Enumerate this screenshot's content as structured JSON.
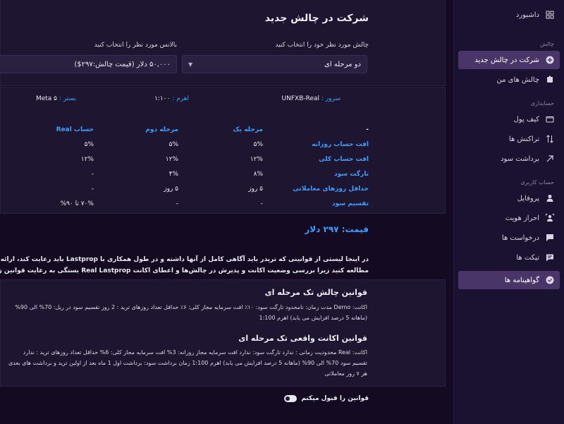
{
  "sidebar": {
    "items": [
      {
        "label": "داشبورد",
        "icon": "grid-icon"
      },
      {
        "group": "چالش"
      },
      {
        "label": "شرکت در چالش جدید",
        "icon": "plus-circle-icon",
        "active": true
      },
      {
        "label": "چالش های من",
        "icon": "trophy-icon"
      },
      {
        "group": "حسابداری"
      },
      {
        "label": "کیف پول",
        "icon": "wallet-icon"
      },
      {
        "label": "تراکنش ها",
        "icon": "swap-icon"
      },
      {
        "label": "برداشت سود",
        "icon": "arrow-out-icon"
      },
      {
        "group": "حساب کاربری"
      },
      {
        "label": "پروفایل",
        "icon": "user-icon"
      },
      {
        "label": "احراز هویت",
        "icon": "id-icon"
      },
      {
        "label": "درخواست ها",
        "icon": "chat-icon"
      },
      {
        "label": "تیکت ها",
        "icon": "ticket-icon"
      },
      {
        "label": "گواهینامه ها",
        "icon": "badge-icon",
        "active": true
      }
    ]
  },
  "main": {
    "title": "شرکت در چالش جدید",
    "challenge_label": "چالش مورد نظر خود را انتخاب کنید",
    "challenge_value": "دو مرحله ای",
    "balance_label": "بالانس مورد نظر را انتخاب کنید",
    "balance_value": "۵۰,۰۰۰ دلار (قیمت چالش:۲۹۷$)",
    "server_key": "سرور :",
    "server_value": "UNFXB-Real",
    "leverage_key": "اهرم :",
    "leverage_value": "۱:۱۰۰",
    "platform_key": "بستر :",
    "platform_value": "Meta ۵",
    "table": {
      "headers": [
        "-",
        "مرحله یک",
        "مرحله دوم",
        "حساب Real"
      ],
      "rows": [
        [
          "افت حساب روزانه",
          "۵%",
          "۵%",
          "۵%"
        ],
        [
          "افت حساب کلی",
          "۱۲%",
          "۱۲%",
          "۱۲%"
        ],
        [
          "تارگت سود",
          "۸%",
          "۴%",
          "-"
        ],
        [
          "حداقل روزهای معاملاتی",
          "۵ روز",
          "۵ روز",
          "-"
        ],
        [
          "تقسیم سود",
          "-",
          "-",
          "۷۰% تا ۹۰%"
        ]
      ]
    },
    "price": "قیمت: ۲۹۷ دلار",
    "desc_line1": "در اینجا لیستی از قوانینی که تریدر باید آگاهی کامل از آنها داشته و در طول همکاری با Lastprop باید رعایت کند، ارائه می‌دهیم. لطفاً با دقت",
    "desc_line2": "مطالعه کنید زیرا بررسی وضعیت اکانت و پذیرش در چالش‌ها و اعطای اکانت Real Lastprop بستگی به رعایت قوانین زیر دارد",
    "rules1_title": "قوانین چالش تک مرحله ای",
    "rules1_text": "اکانت: Demo مدت زمان: نامحدود تارگت سود: ۱۰٪ افت سرمایه مجاز کلی: ۶٪ حداقل تعداد روزهای ترید : 2 روز تقسیم سود در ریل: 70% الی 90% (ماهانه 5 درصد افزایش می یابد) اهرم 1:100",
    "rules2_title": "قوانین اکانت واقعی تک مرحله ای",
    "rules2_text": "اکانت: Real محدودیت زمانی : ندارد تارگت سود: ندارد افت سرمایه مجاز روزانه: 3% افت سرمایه مجاز کلی: 6% حداقل تعداد روزهای ترید : ندارد تقسیم سود 70% الی 90% (ماهانه 5 درصد افزایش می یابد) اهرم 1:100 زمان برداشت سود: برداشت اول 1 ماه بعد از اولین ترید و برداشت های بعدی هر ۷ روز معاملاتی",
    "accept_label": "قوانین را قبول میکنم"
  },
  "colors": {
    "accent_blue": "#3aa0ff",
    "active_item": "#4a3569",
    "background": "#140a22"
  }
}
